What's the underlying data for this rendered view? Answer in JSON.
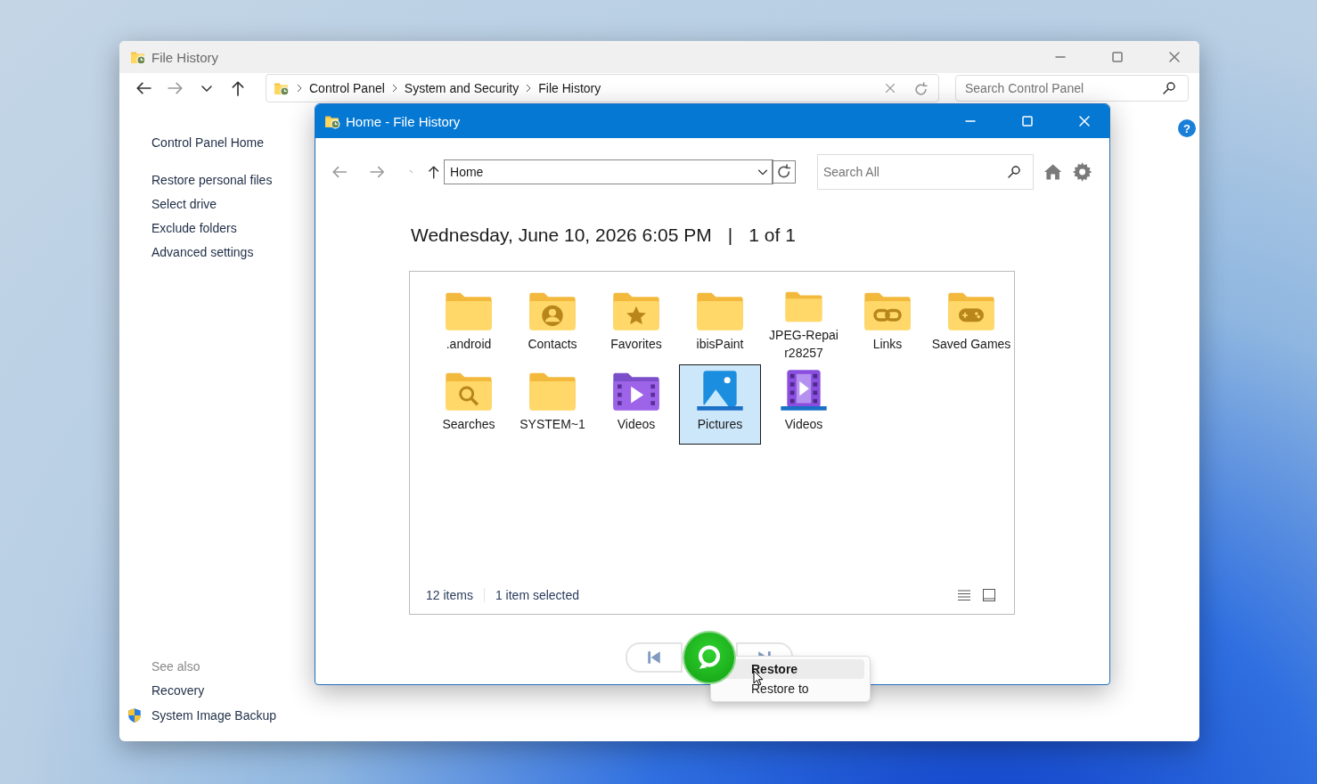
{
  "back_window": {
    "title": "File History",
    "breadcrumb": [
      "Control Panel",
      "System and Security",
      "File History"
    ],
    "search": {
      "placeholder": "Search Control Panel"
    },
    "help": "?",
    "sidebar": {
      "items": [
        {
          "label": "Control Panel Home",
          "kind": "home"
        },
        {
          "label": "Restore personal files",
          "kind": "task"
        },
        {
          "label": "Select drive",
          "kind": "task"
        },
        {
          "label": "Exclude folders",
          "kind": "task"
        },
        {
          "label": "Advanced settings",
          "kind": "task"
        }
      ],
      "see_also": {
        "heading": "See also",
        "items": [
          {
            "label": "Recovery",
            "shield": false
          },
          {
            "label": "System Image Backup",
            "shield": true
          }
        ]
      }
    }
  },
  "front_window": {
    "title": "Home - File History",
    "address": "Home",
    "search": {
      "placeholder": "Search All"
    },
    "backup_date": "Wednesday, June 10, 2026 6:05 PM",
    "separator": "|",
    "page_count": "1 of 1",
    "items": [
      {
        "label": ".android",
        "kind": "folder",
        "selected": false
      },
      {
        "label": "Contacts",
        "kind": "contacts",
        "selected": false
      },
      {
        "label": "Favorites",
        "kind": "favorites",
        "selected": false
      },
      {
        "label": "ibisPaint",
        "kind": "folder",
        "selected": false
      },
      {
        "label": "JPEG-Repai r28257",
        "kind": "folder",
        "selected": false
      },
      {
        "label": "Links",
        "kind": "links",
        "selected": false
      },
      {
        "label": "Saved Games",
        "kind": "games",
        "selected": false
      },
      {
        "label": "Searches",
        "kind": "searches",
        "selected": false
      },
      {
        "label": "SYSTEM~1",
        "kind": "folder",
        "selected": false
      },
      {
        "label": "Videos",
        "kind": "video-folder",
        "selected": false
      },
      {
        "label": "Pictures",
        "kind": "pictures",
        "selected": true
      },
      {
        "label": "Videos",
        "kind": "video-library",
        "selected": false
      }
    ],
    "status": {
      "count": "12 items",
      "selection": "1 item selected"
    },
    "context_menu": [
      {
        "label": "Restore",
        "selected": true
      },
      {
        "label": "Restore to",
        "selected": false
      }
    ]
  }
}
